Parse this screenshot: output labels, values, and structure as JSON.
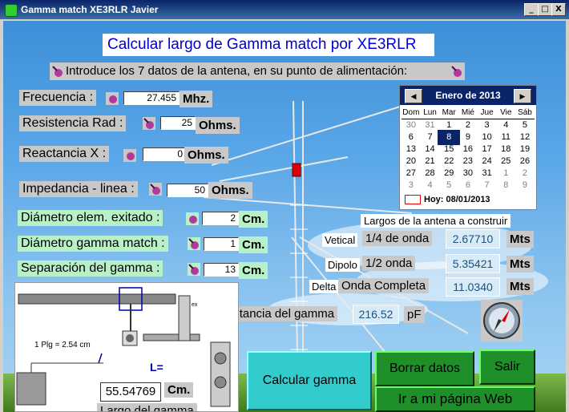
{
  "window": {
    "title": "Gamma match XE3RLR Javier",
    "minimize_label": "_",
    "maximize_label": "□",
    "close_label": "X"
  },
  "header": {
    "title": "Calcular largo de Gamma match por XE3RLR",
    "instruction": "Introduce  los   7   datos de la antena,  en su punto de alimentación:"
  },
  "fields": {
    "frecuencia": {
      "label": "Frecuencia :",
      "value": "27.455",
      "unit": "Mhz."
    },
    "resistencia": {
      "label": "Resistencia Rad :",
      "value": "25",
      "unit": "Ohms."
    },
    "reactancia": {
      "label": "Reactancia X :",
      "value": "0",
      "unit": "Ohms."
    },
    "impedancia": {
      "label": "Impedancia - linea :",
      "value": "50",
      "unit": "Ohms."
    },
    "diametro_elem": {
      "label": "Diámetro elem. exitado  :",
      "value": "2",
      "unit": "Cm."
    },
    "diametro_gamma": {
      "label": "Diámetro gamma match  :",
      "value": "1",
      "unit": "Cm."
    },
    "separacion": {
      "label": "Separación del  gamma  :",
      "value": "13",
      "unit": "Cm."
    }
  },
  "calendar": {
    "month_label": "Enero de 2013",
    "prev_label": "◀",
    "next_label": "▶",
    "weekdays": [
      "Dom",
      "Lun",
      "Mar",
      "Mié",
      "Jue",
      "Vie",
      "Sáb"
    ],
    "weeks": [
      [
        "30",
        "31",
        "1",
        "2",
        "3",
        "4",
        "5"
      ],
      [
        "6",
        "7",
        "8",
        "9",
        "10",
        "11",
        "12"
      ],
      [
        "13",
        "14",
        "15",
        "16",
        "17",
        "18",
        "19"
      ],
      [
        "20",
        "21",
        "22",
        "23",
        "24",
        "25",
        "26"
      ],
      [
        "27",
        "28",
        "29",
        "30",
        "31",
        "1",
        "2"
      ],
      [
        "3",
        "4",
        "5",
        "6",
        "7",
        "8",
        "9"
      ]
    ],
    "today_label": "Hoy: 08/01/2013"
  },
  "results": {
    "section_title": "Largos  de la antena a construir",
    "vertical": {
      "tag": "Vetical",
      "name": "1/4 de onda",
      "value": "2.67710",
      "unit": "Mts"
    },
    "dipolo": {
      "tag": "Dipolo",
      "name": "1/2      onda",
      "value": "5.35421",
      "unit": "Mts"
    },
    "delta": {
      "tag": "Delta",
      "name": "Onda Completa",
      "value": "11.0340",
      "unit": "Mts"
    }
  },
  "capacitancia": {
    "label": "Capacitancia del gamma",
    "value": "216.52",
    "unit": "pF"
  },
  "diagram": {
    "note": "1 Plg = 2.54 cm",
    "l_label": "L=",
    "largo_value": "55.54769",
    "largo_unit": "Cm.",
    "largo_label": "Largo del gamma",
    "ex_label": "ex"
  },
  "buttons": {
    "calcular": "Calcular gamma",
    "borrar": "Borrar datos",
    "salir": "Salir",
    "web": "Ir a  mi  página  Web"
  },
  "colors": {
    "title_bar": "#0a246a",
    "label_grey": "#c8c8c8",
    "label_green": "#b8f0c8",
    "button_cyan": "#33cccc",
    "button_green": "#1f8f2a",
    "header_text": "#0000cc"
  }
}
